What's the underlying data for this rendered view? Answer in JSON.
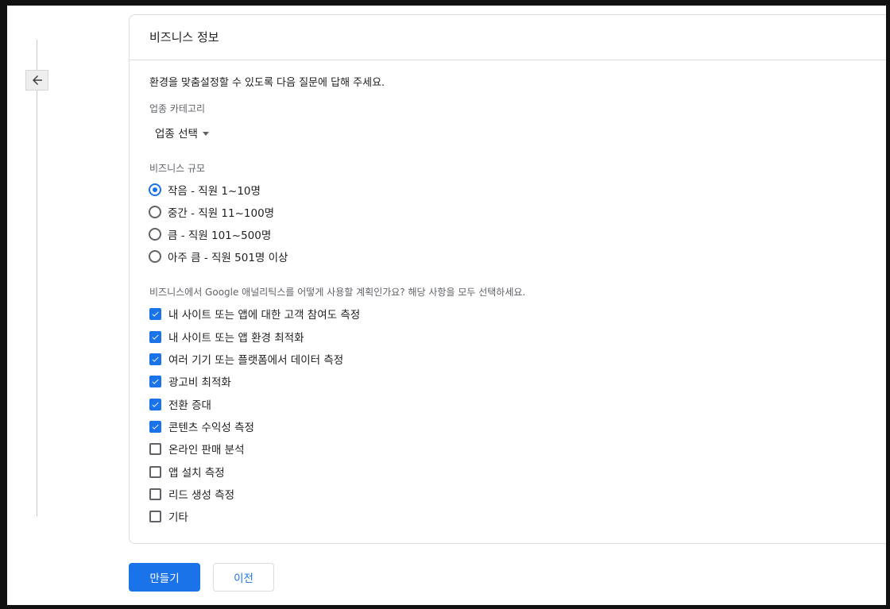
{
  "nav": {
    "back_icon": "arrow-left-icon"
  },
  "card": {
    "title": "비즈니스 정보",
    "intro": "환경을 맞춤설정할 수 있도록 다음 질문에 답해 주세요."
  },
  "industry": {
    "label": "업종 카테고리",
    "selected": "업종 선택"
  },
  "size": {
    "label": "비즈니스 규모",
    "options": [
      {
        "label": "작음 - 직원 1~10명",
        "checked": true
      },
      {
        "label": "중간 - 직원 11~100명",
        "checked": false
      },
      {
        "label": "큼 - 직원 101~500명",
        "checked": false
      },
      {
        "label": "아주 큼 - 직원 501명 이상",
        "checked": false
      }
    ]
  },
  "usage": {
    "question": "비즈니스에서 Google 애널리틱스를 어떻게 사용할 계획인가요? 해당 사항을 모두 선택하세요.",
    "options": [
      {
        "label": "내 사이트 또는 앱에 대한 고객 참여도 측정",
        "checked": true
      },
      {
        "label": "내 사이트 또는 앱 환경 최적화",
        "checked": true
      },
      {
        "label": "여러 기기 또는 플랫폼에서 데이터 측정",
        "checked": true
      },
      {
        "label": "광고비 최적화",
        "checked": true
      },
      {
        "label": "전환 증대",
        "checked": true
      },
      {
        "label": "콘텐츠 수익성 측정",
        "checked": true
      },
      {
        "label": "온라인 판매 분석",
        "checked": false
      },
      {
        "label": "앱 설치 측정",
        "checked": false
      },
      {
        "label": "리드 생성 측정",
        "checked": false
      },
      {
        "label": "기타",
        "checked": false
      }
    ]
  },
  "actions": {
    "create_label": "만들기",
    "previous_label": "이전"
  },
  "colors": {
    "accent": "#1a73e8",
    "border": "#dadce0",
    "text": "#202124",
    "muted": "#5f6368"
  }
}
